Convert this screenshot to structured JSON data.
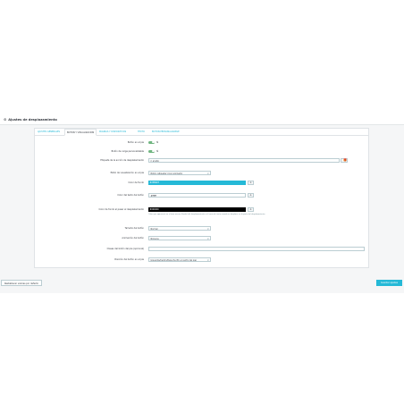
{
  "header": {
    "title": "Ajustes de desplazamiento",
    "icon": "settings-icon"
  },
  "tabs": [
    {
      "label": "AJUSTES GENERALES",
      "active": false
    },
    {
      "label": "BOTÓN Y VISUALIZACIÓN",
      "active": true
    },
    {
      "label": "PÁGINAS Y DISPOSITIVOS",
      "active": false
    },
    {
      "label": "TEXTO",
      "active": false
    },
    {
      "label": "BOTÓN PERSONALIZABLE",
      "active": false
    }
  ],
  "form": {
    "row1": {
      "label": "Botón en el pie",
      "toggle_text": "SÍ"
    },
    "row2": {
      "label": "Botón de carga personalizable",
      "toggle_text": "SÍ"
    },
    "row3": {
      "label": "Etiqueta de la acción de desplazamiento",
      "value": "ir al sitio",
      "btn_text": "···"
    },
    "row4": {
      "label": "Estilo de visualización en el pie",
      "value": "Botón (etiquetar icono animado)"
    },
    "row5": {
      "label": "Color de fondo",
      "value": "#25B9D7"
    },
    "row6": {
      "label": "Color del texto del botón",
      "value": "#ffffff"
    },
    "row7": {
      "label": "Color de fondo al pasar el desplazamiento",
      "value": "#000000",
      "help": "Color que aparecerá en el área oscura (fondo) del desplazamiento o el icono de texto cuando se desplace en la parte del desplazamiento."
    },
    "row8": {
      "label": "Tamaño del botón",
      "value": "Normal"
    },
    "row9": {
      "label": "Animación del botón",
      "value": "Ninguna"
    },
    "row10": {
      "label": "Clases del botón del pie (opcional)",
      "value": ""
    },
    "row11": {
      "label": "Posición del botón en el pie",
      "value": "Izquierda/Centro/Derecha (En el centro del pie)"
    }
  },
  "footer": {
    "reset_label": "Restablecer valores por defecto",
    "save_label": "Guardar ajustes"
  },
  "colors": {
    "accent": "#25b9d7",
    "toggle": "#70b580",
    "black": "#000000"
  }
}
